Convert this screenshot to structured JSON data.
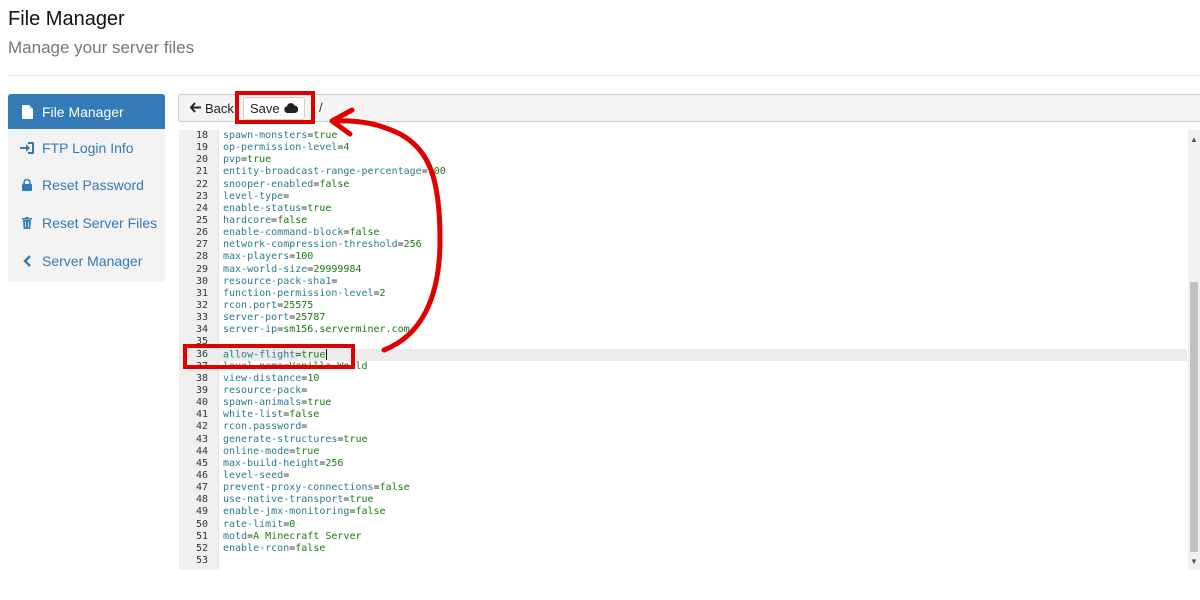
{
  "header": {
    "title": "File Manager",
    "subtitle": "Manage your server files"
  },
  "sidebar": {
    "items": [
      {
        "label": "File Manager",
        "icon": "file-icon",
        "active": true
      },
      {
        "label": "FTP Login Info",
        "icon": "sign-in-icon",
        "active": false
      },
      {
        "label": "Reset Password",
        "icon": "lock-icon",
        "active": false
      },
      {
        "label": "Reset Server Files",
        "icon": "trash-icon",
        "active": false
      },
      {
        "label": "Server Manager",
        "icon": "chevron-left-icon",
        "active": false
      }
    ]
  },
  "toolbar": {
    "back_label": "Back",
    "save_label": "Save",
    "path": "/"
  },
  "editor": {
    "active_line": 36,
    "lines": [
      {
        "n": "18",
        "key": "spawn-monsters",
        "value": "true"
      },
      {
        "n": "19",
        "key": "op-permission-level",
        "value": "4"
      },
      {
        "n": "20",
        "key": "pvp",
        "value": "true"
      },
      {
        "n": "21",
        "key": "entity-broadcast-range-percentage",
        "value": "100"
      },
      {
        "n": "22",
        "key": "snooper-enabled",
        "value": "false"
      },
      {
        "n": "23",
        "key": "level-type",
        "value": ""
      },
      {
        "n": "24",
        "key": "enable-status",
        "value": "true"
      },
      {
        "n": "25",
        "key": "hardcore",
        "value": "false"
      },
      {
        "n": "26",
        "key": "enable-command-block",
        "value": "false"
      },
      {
        "n": "27",
        "key": "network-compression-threshold",
        "value": "256"
      },
      {
        "n": "28",
        "key": "max-players",
        "value": "100"
      },
      {
        "n": "29",
        "key": "max-world-size",
        "value": "29999984"
      },
      {
        "n": "30",
        "key": "resource-pack-sha1",
        "value": ""
      },
      {
        "n": "31",
        "key": "function-permission-level",
        "value": "2"
      },
      {
        "n": "32",
        "key": "rcon.port",
        "value": "25575"
      },
      {
        "n": "33",
        "key": "server-port",
        "value": "25787"
      },
      {
        "n": "34",
        "key": "server-ip",
        "value": "sm156.serverminer.com"
      },
      {
        "n": "35",
        "key": "",
        "value": ""
      },
      {
        "n": "36",
        "key": "allow-flight",
        "value": "true"
      },
      {
        "n": "37",
        "key": "level-name",
        "value": "Vanilla World"
      },
      {
        "n": "38",
        "key": "view-distance",
        "value": "10"
      },
      {
        "n": "39",
        "key": "resource-pack",
        "value": ""
      },
      {
        "n": "40",
        "key": "spawn-animals",
        "value": "true"
      },
      {
        "n": "41",
        "key": "white-list",
        "value": "false"
      },
      {
        "n": "42",
        "key": "rcon.password",
        "value": ""
      },
      {
        "n": "43",
        "key": "generate-structures",
        "value": "true"
      },
      {
        "n": "44",
        "key": "online-mode",
        "value": "true"
      },
      {
        "n": "45",
        "key": "max-build-height",
        "value": "256"
      },
      {
        "n": "46",
        "key": "level-seed",
        "value": ""
      },
      {
        "n": "47",
        "key": "prevent-proxy-connections",
        "value": "false"
      },
      {
        "n": "48",
        "key": "use-native-transport",
        "value": "true"
      },
      {
        "n": "49",
        "key": "enable-jmx-monitoring",
        "value": "false"
      },
      {
        "n": "50",
        "key": "rate-limit",
        "value": "0"
      },
      {
        "n": "51",
        "key": "motd",
        "value": "A Minecraft Server"
      },
      {
        "n": "52",
        "key": "enable-rcon",
        "value": "false"
      },
      {
        "n": "53",
        "key": "",
        "value": ""
      }
    ]
  },
  "colors": {
    "accent": "#337ab7",
    "annotation": "#e00000",
    "key": "#2b7c8a",
    "value": "#1a7a10"
  }
}
